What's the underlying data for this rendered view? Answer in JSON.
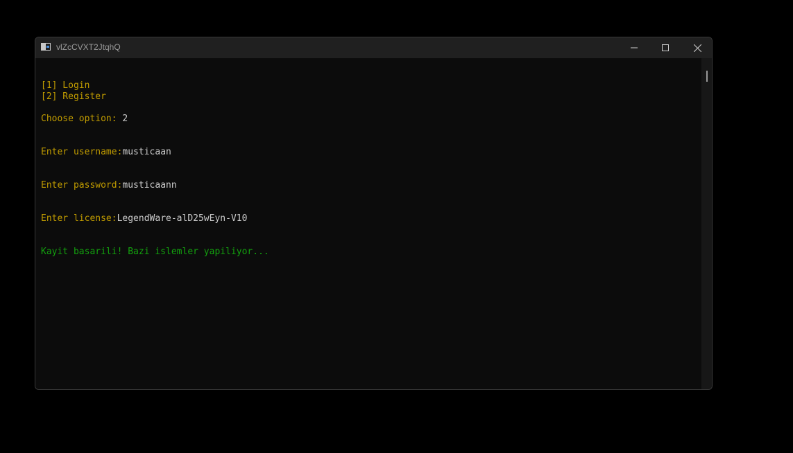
{
  "window": {
    "title": "vlZcCVXT2JtqhQ"
  },
  "terminal": {
    "menu_login": "[1] Login",
    "menu_register": "[2] Register",
    "choose_prompt": "Choose option: ",
    "choose_value": "2",
    "username_prompt": "Enter username:",
    "username_value": "musticaan",
    "password_prompt": "Enter password:",
    "password_value": "musticaann",
    "license_prompt": "Enter license:",
    "license_value": "LegendWare-alD25wEyn-V10",
    "success_message": "Kayit basarili! Bazi islemler yapiliyor..."
  },
  "colors": {
    "prompt": "#c19c00",
    "value": "#cccccc",
    "success": "#13a10e",
    "background": "#0c0c0c",
    "titlebar": "#202020"
  },
  "icons": {
    "app": "console-window-icon",
    "minimize": "minimize-icon",
    "maximize": "maximize-icon",
    "close": "close-icon"
  }
}
